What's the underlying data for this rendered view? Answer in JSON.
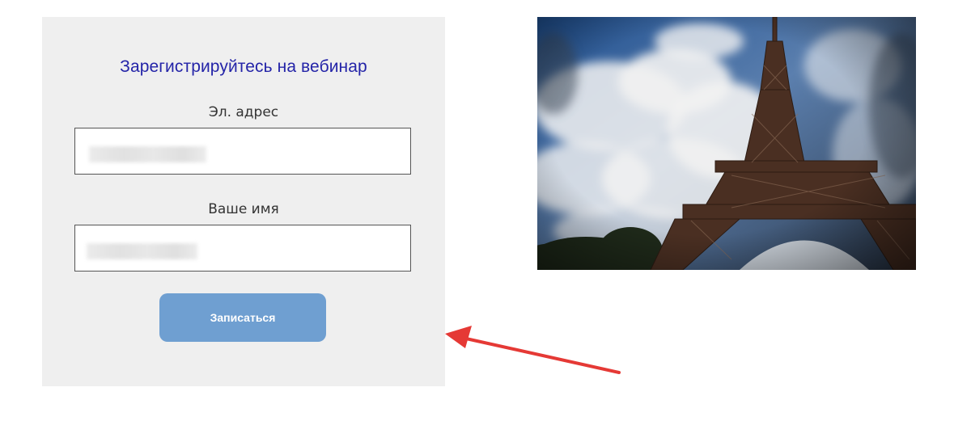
{
  "form": {
    "title": "Зарегистрируйтесь на вебинар",
    "email_label": "Эл. адрес",
    "email_value": "",
    "name_label": "Ваше имя",
    "name_value": "",
    "submit_label": "Записаться"
  },
  "photo": {
    "icon": "eiffel-tower-photo"
  },
  "annotation": {
    "icon": "red-arrow-icon",
    "color": "#e53935"
  },
  "colors": {
    "title": "#2424a8",
    "button": "#6f9fd1",
    "panel": "#efefef"
  }
}
